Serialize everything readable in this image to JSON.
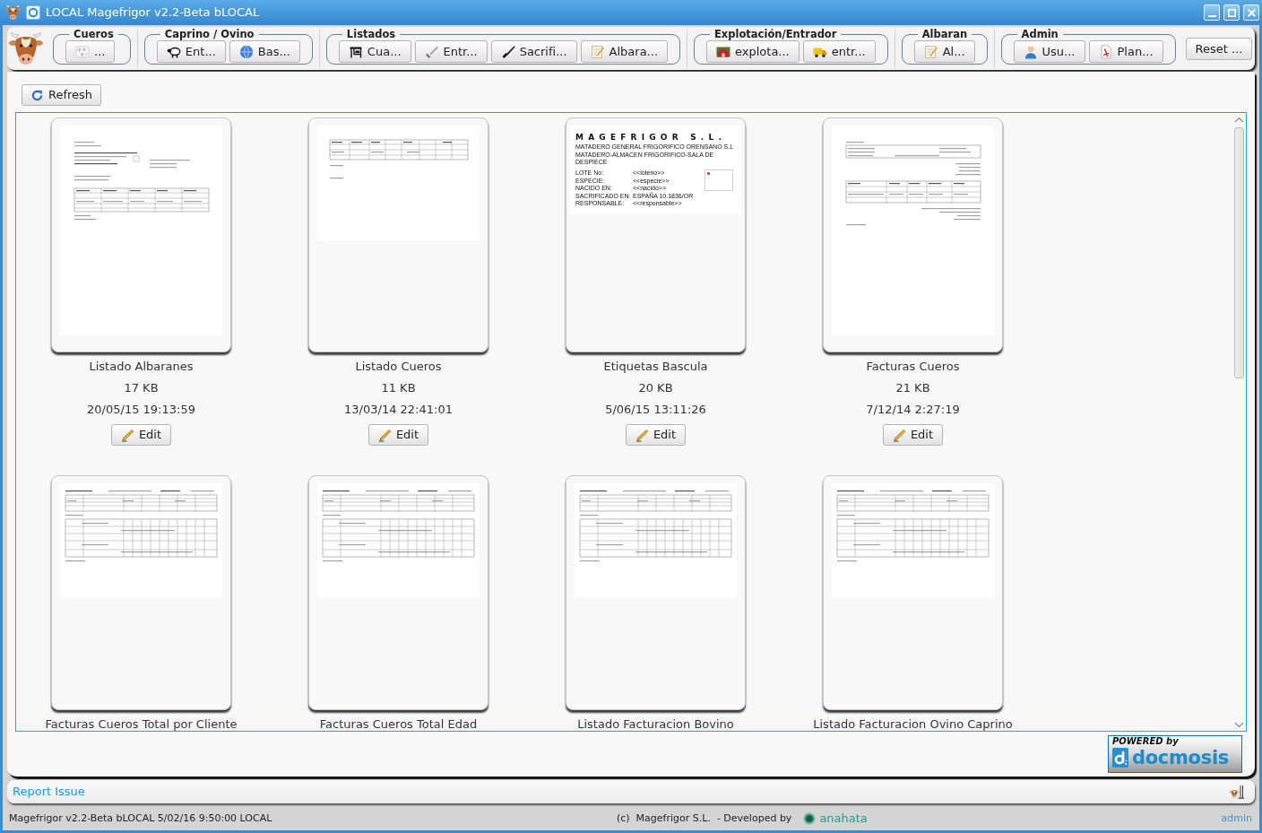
{
  "window": {
    "title": "LOCAL Magefrigor v2.2-Beta bLOCAL"
  },
  "toolbar": {
    "groups": [
      {
        "title": "Cueros",
        "buttons": [
          "..."
        ]
      },
      {
        "title": "Caprino / Ovino",
        "buttons": [
          "Ent...",
          "Bas..."
        ]
      },
      {
        "title": "Listados",
        "buttons": [
          "Cua...",
          "Entr...",
          "Sacrifi...",
          "Albara..."
        ]
      },
      {
        "title": "Explotación/Entrador",
        "buttons": [
          "explota...",
          "entr..."
        ]
      },
      {
        "title": "Albaran",
        "buttons": [
          "Al..."
        ]
      },
      {
        "title": "Admin",
        "buttons": [
          "Usu...",
          "Plan..."
        ]
      }
    ],
    "reset_button": "Reset ..."
  },
  "refresh_button": "Refresh",
  "templates": [
    {
      "kind": "note",
      "name": "Listado Albaranes",
      "size": "17 KB",
      "modified": "20/05/15 19:13:59",
      "action": "Edit"
    },
    {
      "kind": "sheet",
      "name": "Listado Cueros",
      "size": "11 KB",
      "modified": "13/03/14 22:41:01",
      "action": "Edit"
    },
    {
      "kind": "label",
      "name": "Etiquetas Bascula",
      "size": "20 KB",
      "modified": "5/06/15 13:11:26",
      "action": "Edit",
      "preview": {
        "heading": "MAGEFRIGOR S.L.",
        "subtitles": [
          "MATADERO GENERAL FRIGORIFICO ORENSANO S.L",
          "MATADERO-ALMACEN FRIGORIFICO-SALA DE DESPIECE"
        ],
        "fields": [
          {
            "label": "LOTE No:",
            "value": "<<loteno>>"
          },
          {
            "label": "ESPECIE:",
            "value": "<<especie>>"
          },
          {
            "label": "NACIDO EN:",
            "value": "<<nacido>>"
          },
          {
            "label": "SACRIFICADO EN:",
            "value": "ESPAÑA 10.1836/OR"
          },
          {
            "label": "RESPONSABLE:",
            "value": "<<responsable>>"
          }
        ]
      }
    },
    {
      "kind": "invoice",
      "name": "Facturas Cueros",
      "size": "21 KB",
      "modified": "7/12/14 2:27:19",
      "action": "Edit"
    },
    {
      "kind": "report",
      "name": "Facturas Cueros Total por Cliente"
    },
    {
      "kind": "report",
      "name": "Facturas Cueros Total Edad"
    },
    {
      "kind": "report",
      "name": "Listado Facturacion Bovino"
    },
    {
      "kind": "report",
      "name": "Listado Facturacion Ovino Caprino"
    }
  ],
  "powered_by": {
    "caption": "POWERED by",
    "brand": "docmosis"
  },
  "report_link": "Report Issue",
  "status_bar": {
    "build": "Magefrigor v2.2-Beta bLOCAL 5/02/16 9:50:00 LOCAL",
    "credits": "(c)  Magefrigor S.L.  - Developed by",
    "developer": "anahata",
    "user": "admin"
  }
}
